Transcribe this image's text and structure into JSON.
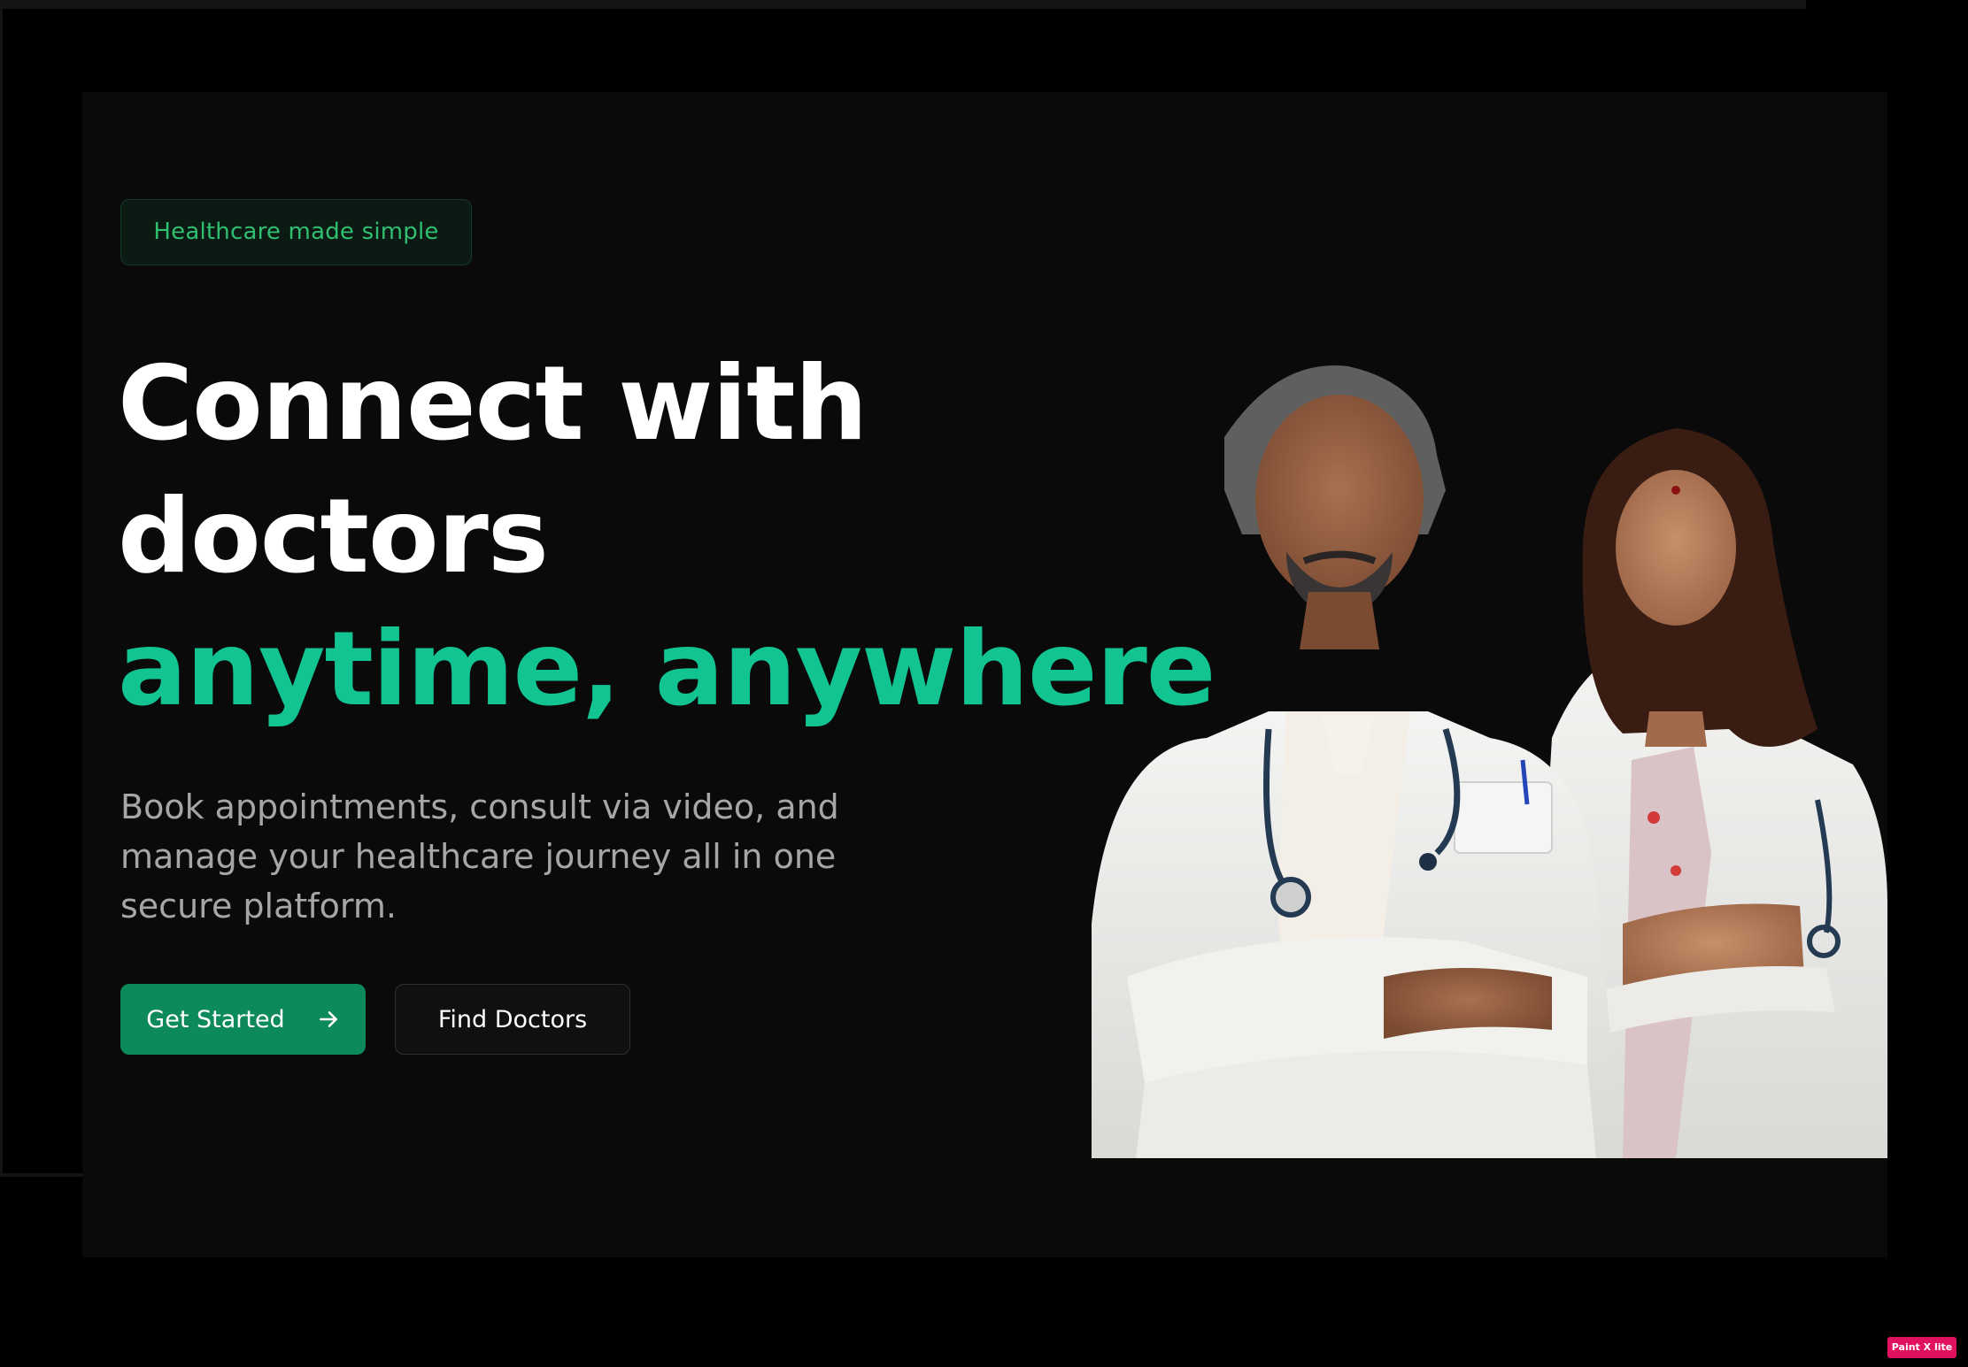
{
  "hero": {
    "tag": "Healthcare made simple",
    "headline": {
      "line1": "Connect with",
      "line2": "doctors",
      "accent": "anytime, anywhere"
    },
    "subtext": "Book appointments, consult via video, and manage your healthcare journey all in one secure platform.",
    "primary_button": {
      "label": "Get Started",
      "icon": "arrow-right-icon"
    },
    "secondary_button": {
      "label": "Find Doctors"
    },
    "image": {
      "subject": "doctors-photo"
    }
  },
  "watermark": {
    "text": "Paint X lite"
  },
  "colors": {
    "background": "#000000",
    "card": "#0a0a0a",
    "accent": "#11c491",
    "button_primary": "#0d8a5c",
    "tag_text": "#2fbf71",
    "subtext": "#a6a6a6",
    "watermark": "#e0115f"
  }
}
